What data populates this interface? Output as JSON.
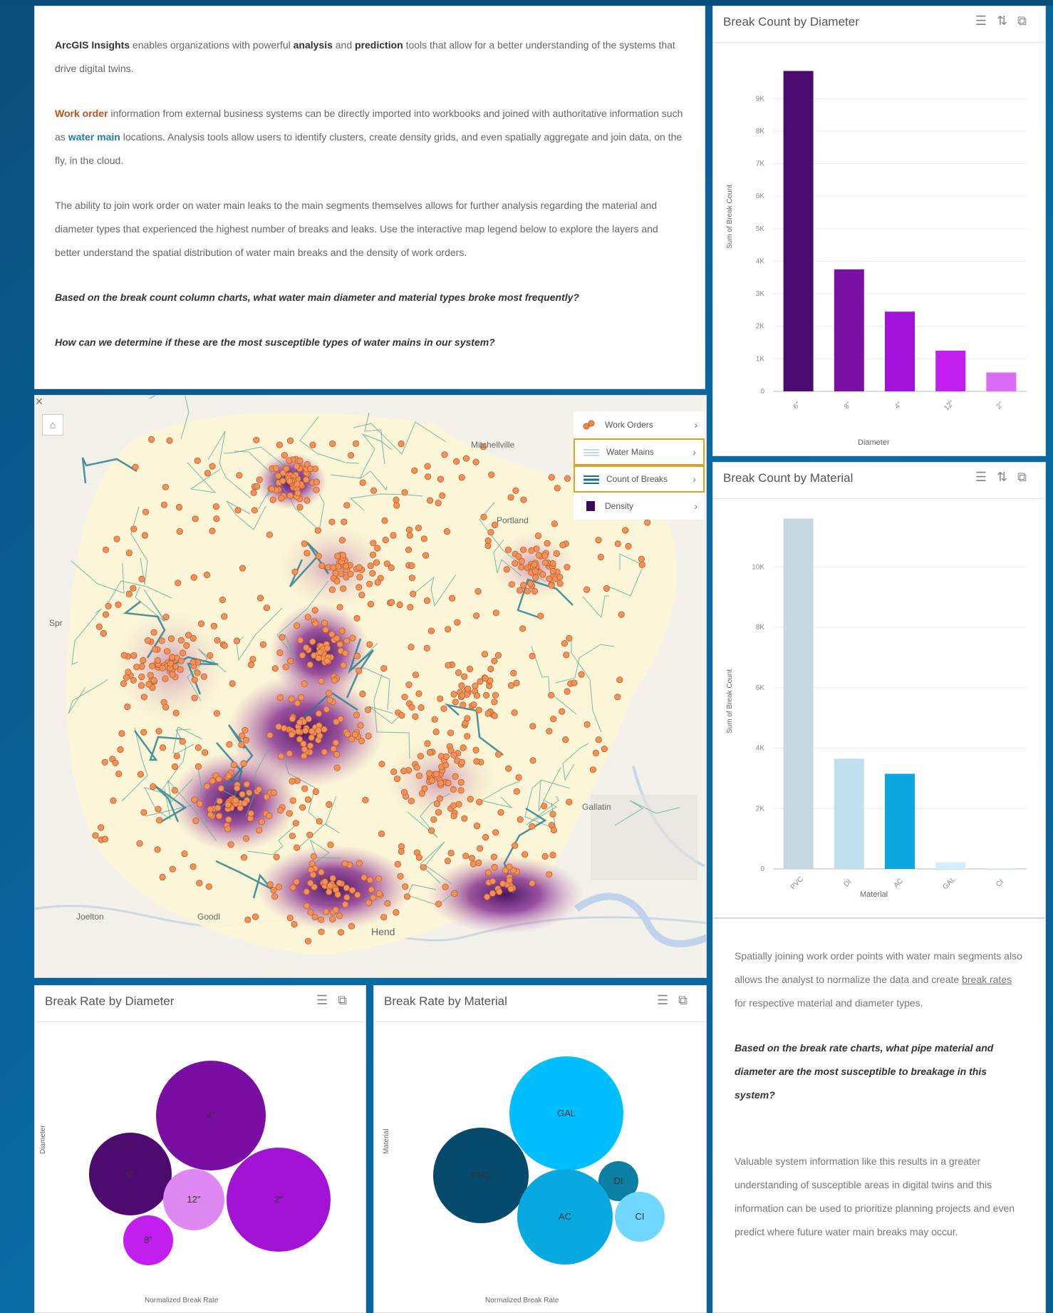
{
  "intro": {
    "p1_bold": "ArcGIS Insights",
    "p1_mid": " enables organizations with powerful ",
    "p1_analysis": "analysis",
    "p1_and": " and ",
    "p1_prediction": "prediction",
    "p1_end": " tools that allow for a better understanding of the systems that drive digital twins.",
    "p2_work_order": "Work order",
    "p2_mid": " information from external business systems can be directly imported into workbooks and joined with authoritative information such as ",
    "p2_water_main": "water main",
    "p2_end": " locations. Analysis tools allow users to identify clusters, create density grids, and even spatially aggregate and join data, on the fly, in the cloud.",
    "p3": "The ability to join work order on water main leaks to the main segments themselves allows for further analysis regarding the material and diameter types that experienced the highest number of breaks and leaks. Use the interactive map legend below to explore the layers and better understand the spatial distribution of water main breaks and the density of work orders.",
    "q1": "Based on the break count column charts, what water main diameter and material types broke most frequently?",
    "q2": "How can we determine if these are the most susceptible types of water mains in our system?"
  },
  "map": {
    "legend": [
      {
        "label": "Work Orders",
        "icon": "work-orders-icon"
      },
      {
        "label": "Water Mains",
        "icon": "water-mains-icon"
      },
      {
        "label": "Count of Breaks",
        "icon": "count-of-breaks-icon"
      },
      {
        "label": "Density",
        "icon": "density-icon"
      }
    ],
    "places": [
      "Mitchellville",
      "Portland",
      "Gallatin",
      "Hend",
      "Goodl",
      "Joelton",
      "Spr"
    ]
  },
  "note": {
    "p1_a": "Spatially joining work order points with water main segments also allows the analyst to normalize the data and create ",
    "p1_link": "break rates",
    "p1_b": " for respective material and diameter types.",
    "q": "Based on the break rate charts, what pipe material and diameter are the most susceptible to breakage in this system?",
    "p2": "Valuable system information like this results in a greater understanding of susceptible areas in digital twins and this information can be used to prioritize planning projects and even predict where future water main breaks may occur."
  },
  "chart_data": [
    {
      "title": "Break Count by Diameter",
      "type": "bar",
      "xlabel": "Diameter",
      "ylabel": "Sum of Break Count",
      "categories": [
        "6\"",
        "8\"",
        "4\"",
        "12\"",
        "2\""
      ],
      "values": [
        9850,
        3750,
        2450,
        1250,
        580
      ],
      "colors": [
        "#4b0a6e",
        "#7b10a6",
        "#a312d9",
        "#c31ef0",
        "#d86cf2"
      ],
      "yticks": [
        "0",
        "1K",
        "2K",
        "3K",
        "4K",
        "5K",
        "6K",
        "7K",
        "8K",
        "9K"
      ],
      "ylim": [
        0,
        10300
      ]
    },
    {
      "title": "Break Count by Material",
      "type": "bar",
      "xlabel": "Material",
      "ylabel": "Sum of Break Count",
      "categories": [
        "PVC",
        "DI",
        "AC",
        "GAL",
        "CI"
      ],
      "values": [
        11600,
        3650,
        3150,
        220,
        30
      ],
      "colors": [
        "#c8d8e2",
        "#bfe1ef",
        "#0ca6e0",
        "#d3efff",
        "#d8f0ff"
      ],
      "yticks": [
        "0",
        "2K",
        "4K",
        "6K",
        "8K",
        "10K"
      ],
      "ylim": [
        0,
        11800
      ]
    },
    {
      "title": "Break Rate by Diameter",
      "type": "bubble",
      "xlabel": "Normalized Break Rate",
      "ylabel": "Diameter",
      "bubbles": [
        {
          "label": "4\"",
          "color": "#7a0da3"
        },
        {
          "label": "6\"",
          "color": "#4d0a6e"
        },
        {
          "label": "12\"",
          "color": "#df88f2"
        },
        {
          "label": "2\"",
          "color": "#a313d6"
        },
        {
          "label": "8\"",
          "color": "#c21ef0"
        }
      ]
    },
    {
      "title": "Break Rate by Material",
      "type": "bubble",
      "xlabel": "Normalized Break Rate",
      "ylabel": "Material",
      "bubbles": [
        {
          "label": "GAL",
          "color": "#00bfff"
        },
        {
          "label": "PVC",
          "color": "#05496d"
        },
        {
          "label": "DI",
          "color": "#0b7ea3"
        },
        {
          "label": "AC",
          "color": "#07a9e0"
        },
        {
          "label": "CI",
          "color": "#70d7ff"
        }
      ]
    }
  ]
}
